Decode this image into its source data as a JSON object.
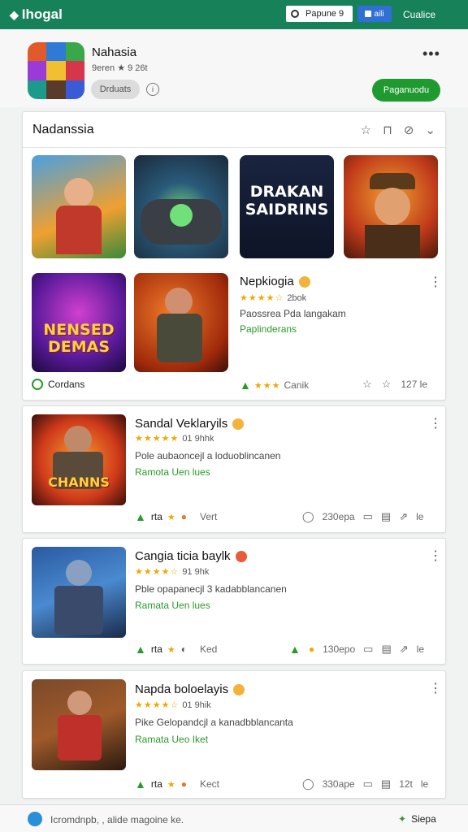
{
  "app": {
    "logo_text": "Ihogal",
    "search_label": "Papune 9",
    "blue_label": "aili",
    "top_link": "Cualice"
  },
  "profile": {
    "name": "Nahasia",
    "sub": "9eren ★ 9 26t",
    "pill": "Drduats",
    "action_button": "Paganuodu"
  },
  "featured": {
    "title": "Nadanssia",
    "tiles": [
      "DRAKAN SAIDRINS",
      "NENSED DEMAS"
    ],
    "item": {
      "title": "Nepkiogia",
      "rating_text": "2bok",
      "desc": "Paossrea Pda langakam",
      "status": "Paplinderans"
    },
    "footer_left": "Cordans",
    "footer_mid": "Canik",
    "footer_right": "127 le"
  },
  "items": [
    {
      "title": "Sandal Veklaryils",
      "rating_text": "01 9hhk",
      "desc": "Pole aubaoncejl a loduoblincanen",
      "status": "Ramota Uen lues",
      "tile_text": "CHANNS",
      "left_label": "Vert",
      "count": "230epa",
      "tail": "le"
    },
    {
      "title": "Cangia ticia baylk",
      "rating_text": "91 9hk",
      "desc": "Pble opapanecjl 3 kadabblancanen",
      "status": "Ramata Uen lues",
      "left_label": "Ked",
      "count": "130epo",
      "tail": "le"
    },
    {
      "title": "Napda boloelayis",
      "rating_text": "01 9hik",
      "desc": "Pike Gelopandcjl a kanadbblancanta",
      "status": "Ramata Ueo Iket",
      "left_label": "Kect",
      "count": "330ape",
      "tail": "le",
      "extra": "12t"
    }
  ],
  "bottom": {
    "text": "Icromdnpb, , alide magoine ke.",
    "right": "Siepa"
  },
  "colors": {
    "topbar": "#17815a",
    "accent_green": "#1f9a2f",
    "star": "#f0a800"
  }
}
